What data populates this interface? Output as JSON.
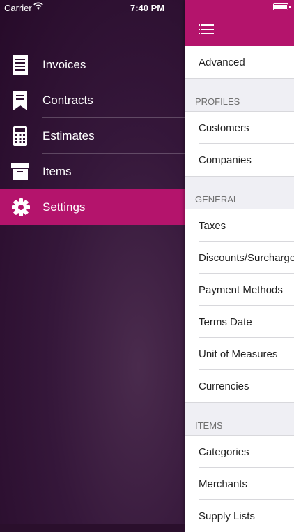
{
  "status": {
    "carrier": "Carrier",
    "time": "7:40 PM"
  },
  "colors": {
    "accent": "#b4146c",
    "sidebar_dark": "#260a29"
  },
  "menu": [
    {
      "label": "Invoices",
      "icon": "invoice-icon"
    },
    {
      "label": "Contracts",
      "icon": "contract-icon"
    },
    {
      "label": "Estimates",
      "icon": "calculator-icon"
    },
    {
      "label": "Items",
      "icon": "archive-box-icon"
    },
    {
      "label": "Settings",
      "icon": "gear-icon",
      "active": true
    }
  ],
  "settings": {
    "advanced": "Advanced",
    "profiles_header": "PROFILES",
    "customers": "Customers",
    "companies": "Companies",
    "general_header": "GENERAL",
    "taxes": "Taxes",
    "discounts": "Discounts/Surcharges",
    "payment_methods": "Payment Methods",
    "terms_date": "Terms Date",
    "unit_of_measures": "Unit of Measures",
    "currencies": "Currencies",
    "items_header": "ITEMS",
    "categories": "Categories",
    "merchants": "Merchants",
    "supply_lists": "Supply Lists"
  }
}
